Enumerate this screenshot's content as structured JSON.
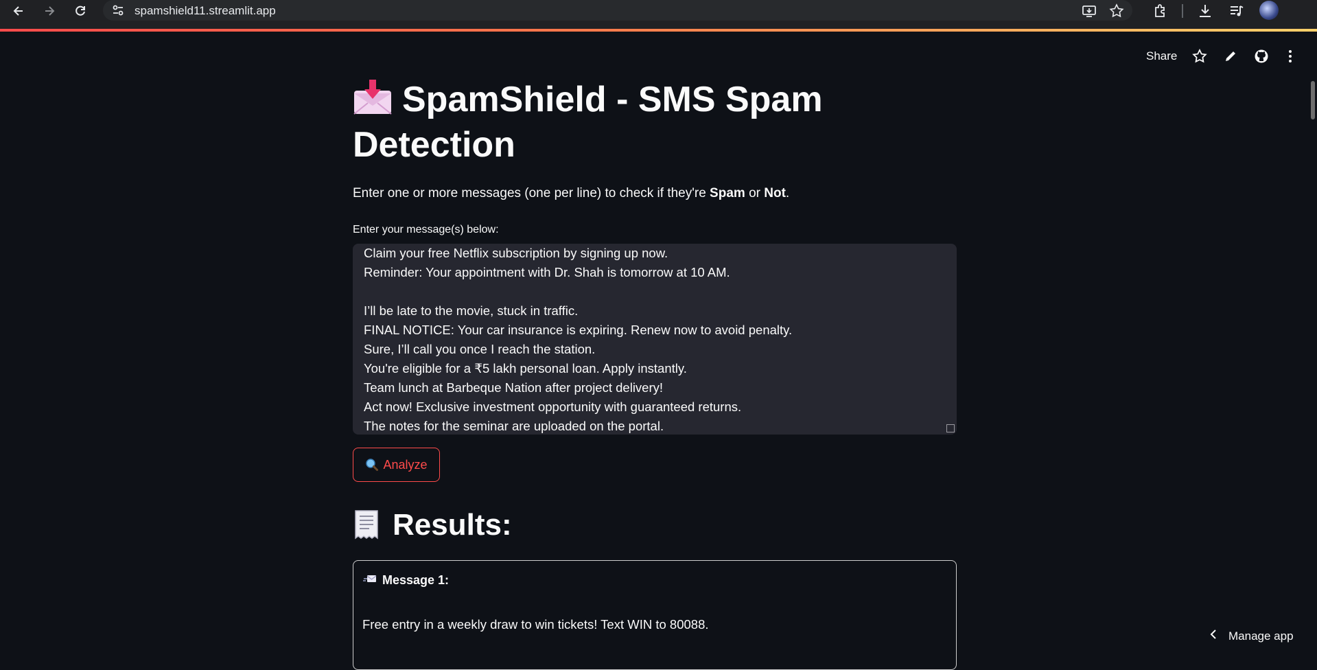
{
  "browser": {
    "url": "spamshield11.streamlit.app",
    "icons": [
      "back-icon",
      "forward-icon",
      "reload-icon",
      "site-settings-icon",
      "install-app-icon",
      "bookmark-star-icon",
      "extensions-icon",
      "download-icon",
      "media-controls-icon",
      "profile-avatar"
    ]
  },
  "toolbar": {
    "share_label": "Share",
    "icons": [
      "star-icon",
      "edit-icon",
      "github-icon",
      "more-vertical-icon"
    ]
  },
  "app": {
    "title": "SpamShield - SMS Spam Detection",
    "title_icon": "envelope-with-arrow-icon",
    "subtitle_pre": "Enter one or more messages (one per line) to check if they're ",
    "subtitle_spam": "Spam",
    "subtitle_or": " or ",
    "subtitle_not": "Not",
    "subtitle_end": ".",
    "input_label": "Enter your message(s) below:",
    "textarea_value": "Claim your free Netflix subscription by signing up now.\nReminder: Your appointment with Dr. Shah is tomorrow at 10 AM.\n\nI’ll be late to the movie, stuck in traffic.\nFINAL NOTICE: Your car insurance is expiring. Renew now to avoid penalty.\nSure, I’ll call you once I reach the station.\nYou're eligible for a ₹5 lakh personal loan. Apply instantly.\nTeam lunch at Barbeque Nation after project delivery!\nAct now! Exclusive investment opportunity with guaranteed returns.\nThe notes for the seminar are uploaded on the portal.",
    "analyze_label": "Analyze",
    "analyze_icon": "magnifying-glass-icon",
    "results_title": "Results:",
    "results_icon": "receipt-icon"
  },
  "results": [
    {
      "heading": "Message 1:",
      "icon": "incoming-envelope-icon",
      "text": "Free entry in a weekly draw to win tickets! Text WIN to 80088."
    }
  ],
  "footer": {
    "manage_label": "Manage app"
  },
  "colors": {
    "accent": "#ff4b4b",
    "background": "#0e1117",
    "input_bg": "#262730"
  }
}
